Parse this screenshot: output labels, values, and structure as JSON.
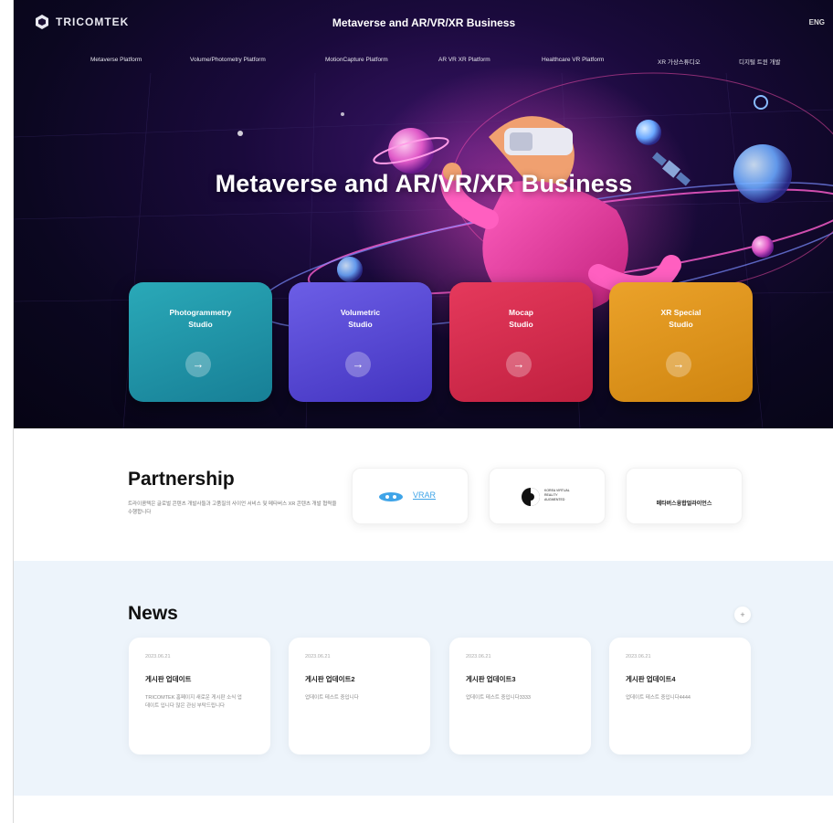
{
  "header": {
    "logo_text": "TRICOMTEK",
    "site_title": "Metaverse and AR/VR/XR Business",
    "lang": "ENG"
  },
  "nav": [
    "Metaverse Platform",
    "Volume/Photometry Platform",
    "MotionCapture Platform",
    "AR VR XR Platform",
    "Healthcare VR Platform",
    "XR 가상스튜디오",
    "디지털 트윈 개발"
  ],
  "hero": {
    "title": "Metaverse and AR/VR/XR Business"
  },
  "studios": [
    {
      "label": "Photogrammetry\nStudio",
      "arrow": "→",
      "color": "#1f8fa3"
    },
    {
      "label": "Volumetric\nStudio",
      "arrow": "→",
      "color": "#5a4fd6"
    },
    {
      "label": "Mocap\nStudio",
      "arrow": "→",
      "color": "#d2304f"
    },
    {
      "label": "XR Special\nStudio",
      "arrow": "→",
      "color": "#d9921a"
    }
  ],
  "partnership": {
    "title": "Partnership",
    "desc": "트라이콤텍은 글로벌 콘텐츠 개발사들과 고품질의 사이언 서비스 및 메타버스 XR 콘텐츠 개발 협력을 수행합니다",
    "partners": [
      {
        "name": "VRAR",
        "icon": "vrar-logo"
      },
      {
        "name": "KOREA VIRTUAL REALITY AUGMENTED",
        "icon": "kvra-logo"
      },
      {
        "name": "메타버스융합얼라이언스",
        "icon": "text-logo"
      }
    ]
  },
  "news": {
    "title": "News",
    "more": "+",
    "items": [
      {
        "date": "2023.06.21",
        "title": "게시판 업데이트",
        "body": "TRICOMTEK 홈페이지 새로운 게시판 소식 업데이트 입니다 많은 관심 부탁드립니다"
      },
      {
        "date": "2023.06.21",
        "title": "게시판 업데이트2",
        "body": "업데이트 테스트 중입니다"
      },
      {
        "date": "2023.06.21",
        "title": "게시판 업데이트3",
        "body": "업데이트 테스트 중입니다3333"
      },
      {
        "date": "2023.06.21",
        "title": "게시판 업데이트4",
        "body": "업데이트 테스트 중입니다4444"
      }
    ]
  }
}
